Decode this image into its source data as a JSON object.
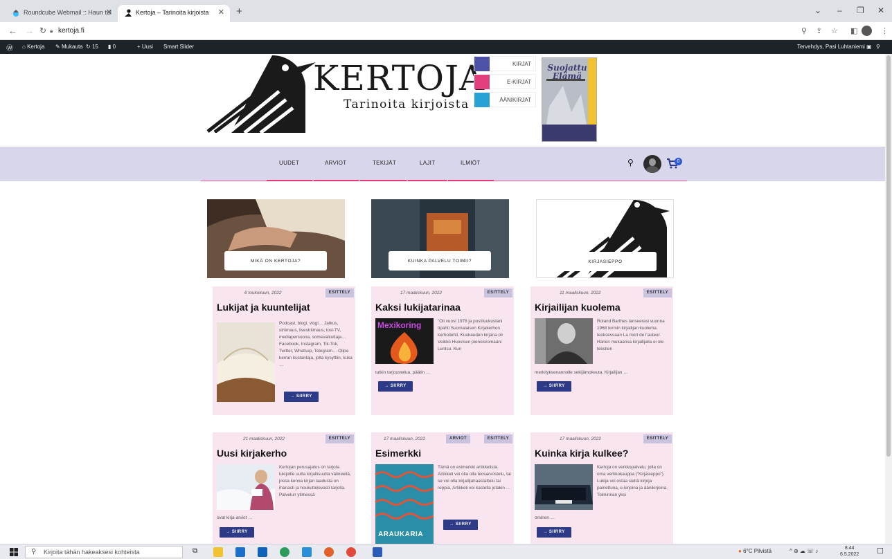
{
  "browser": {
    "tabs": [
      {
        "title": "Roundcube Webmail :: Haun tul"
      },
      {
        "title": "Kertoja – Tarinoita kirjoista"
      }
    ],
    "new_tab": "+",
    "url": "kertoja.fi",
    "window_controls": [
      "⌄",
      "–",
      "❐",
      "✕"
    ]
  },
  "admin_bar": {
    "site": "Kertoja",
    "customize": "Mukauta",
    "updates": "15",
    "comments": "0",
    "new": "Uusi",
    "plugin": "Smart Slider",
    "greeting": "Tervehdys, Pasi Luhtaniemi"
  },
  "header": {
    "title": "KERTOJA",
    "subtitle": "Tarinoita kirjoista",
    "categories": [
      {
        "label": "KIRJAT",
        "color": "#4b52a8"
      },
      {
        "label": "E-KIRJAT",
        "color": "#e0407e"
      },
      {
        "label": "ÄÄNIKIRJAT",
        "color": "#2aa1d6"
      }
    ],
    "ad_book": {
      "title_line1": "Suojattu",
      "title_line2": "Elämä"
    }
  },
  "nav": {
    "items": [
      "UUDET",
      "ARVIOT",
      "TEKIJÄT",
      "LAJIT",
      "ILMIÖT"
    ],
    "cart_count": "0"
  },
  "features": [
    {
      "label": "MIKÄ ON KERTOJA?"
    },
    {
      "label": "KUINKA PALVELU TOIMII?"
    },
    {
      "label": "KIRJASIEPPO"
    }
  ],
  "read_more": "→ SIIRRY",
  "cards": [
    {
      "date": "6 toukokuun, 2022",
      "badges": [
        "ESITTELY"
      ],
      "title": "Lukijat ja kuuntelijat",
      "excerpt": "Podcast, blogi, vlogi… Jatkus, striimaus, livestriimaus, tosi-TV, mediapersoona, somevaikuttaja… Facebook, Instagram, Tik-Tok, Twitter, Whatsup, Telegram… Olipa kerran kustantaja, jolta kysyttiin, kuka …",
      "excerpt_cont": ""
    },
    {
      "date": "17 maaliskuun, 2022",
      "badges": [
        "ESITTELY"
      ],
      "title": "Kaksi lukijatarinaa",
      "excerpt": "”Oli vuosi 1978 ja postiluukustani tipahti Suomalaisen Kirjakerhon kerhoilehti. Kuukauden kirjana oli Veikko Huovisen pienoisromaani Lentsu. Kun",
      "excerpt_cont": "tutkin tarjoustelua, päätin …"
    },
    {
      "date": "11 maaliskuun, 2022",
      "badges": [
        "ESITTELY"
      ],
      "title": "Kirjailijan kuolema",
      "excerpt": "Roland Barthes lanseerasi vuonna 1968 termin kirjailijan kuolema teoksessaan La mort de l'auteur. Hänen mukaansa kirjailijalla ei ole tekstien",
      "excerpt_cont": "merkityksenannolle sekijämokeuta. Kirjailijan …"
    },
    {
      "date": "21 maaliskuun, 2022",
      "badges": [
        "ESITTELY"
      ],
      "title": "Uusi kirjakerho",
      "excerpt": "Kertojan perusajatus on tarjota lukijoille uutta kirjallisuutta välineellä, jossa kenoa kirjan laadusta on ihanasti ja houkuttelevasti tarjolla. Palvelun ytimessä",
      "excerpt_cont": "ovat kirja-arviot …"
    },
    {
      "date": "17 maaliskuun, 2022",
      "badges": [
        "ARVIOT",
        "ESITTELY"
      ],
      "title": "Esimerkki",
      "excerpt": "Tämä on esimerkki artikkelista. Artikkeli voi olla olla teosarvostelu, tai se voi olla kirjailijahaastattelu tai reppia. Artikkeli voi kastella jotakin …",
      "excerpt_cont": ""
    },
    {
      "date": "17 maaliskuun, 2022",
      "badges": [
        "ESITTELY"
      ],
      "title": "Kuinka kirja kulkee?",
      "excerpt": "Kertoja on verkkopalvelu, jolla on oma verkkokauppa (”Kirjasieppo”). Lukija voi ostaa sieltä kirjoja painettuna, e-kirjoina ja äänikirjoina. Toiminnan yksi",
      "excerpt_cont": "ominen …"
    }
  ],
  "thumb_text": {
    "mexikoring": "Mexikoring",
    "araukaria": "ARAUKARIA"
  },
  "taskbar": {
    "search_placeholder": "Kirjoita tähän hakeaksesi kohteista",
    "weather": "6°C Pilvistä",
    "time": "8.44",
    "date": "6.5.2022"
  }
}
